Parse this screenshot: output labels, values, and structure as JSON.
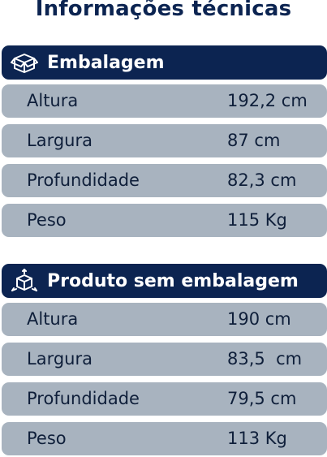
{
  "title": "Informações técnicas",
  "colors": {
    "header_bg": "#0c2451",
    "row_bg": "#a8b3bf",
    "text_dark": "#0f1f3a"
  },
  "sections": [
    {
      "icon": "box-icon",
      "title": "Embalagem",
      "rows": [
        {
          "label": "Altura",
          "value": "192,2 cm"
        },
        {
          "label": "Largura",
          "value": "87 cm"
        },
        {
          "label": "Profundidade",
          "value": "82,3 cm"
        },
        {
          "label": "Peso",
          "value": "115 Kg"
        }
      ]
    },
    {
      "icon": "dimensions-cube-icon",
      "title": "Produto sem embalagem",
      "rows": [
        {
          "label": "Altura",
          "value": "190 cm"
        },
        {
          "label": "Largura",
          "value": "83,5  cm"
        },
        {
          "label": "Profundidade",
          "value": "79,5 cm"
        },
        {
          "label": "Peso",
          "value": "113 Kg"
        }
      ]
    }
  ]
}
